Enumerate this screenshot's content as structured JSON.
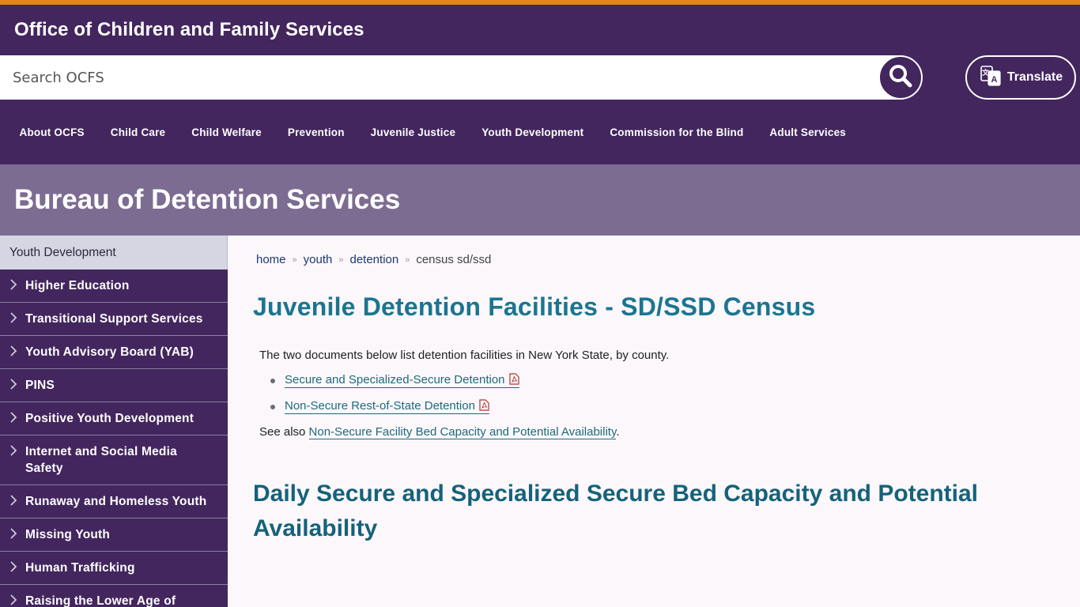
{
  "header": {
    "site_title": "Office of Children and Family Services"
  },
  "search": {
    "placeholder": "Search OCFS",
    "button_icon": "search-icon"
  },
  "translate": {
    "label": "Translate",
    "icon": "translate-icon"
  },
  "main_nav": [
    {
      "label": "About OCFS"
    },
    {
      "label": "Child Care"
    },
    {
      "label": "Child Welfare"
    },
    {
      "label": "Prevention"
    },
    {
      "label": "Juvenile Justice"
    },
    {
      "label": "Youth Development"
    },
    {
      "label": "Commission for the Blind"
    },
    {
      "label": "Adult Services"
    }
  ],
  "banner": {
    "title": "Bureau of Detention Services"
  },
  "sidebar": {
    "heading": "Youth Development",
    "items": [
      {
        "label": "Higher Education"
      },
      {
        "label": "Transitional Support Services"
      },
      {
        "label": "Youth Advisory Board (YAB)"
      },
      {
        "label": "PINS"
      },
      {
        "label": "Positive Youth Development"
      },
      {
        "label": "Internet and Social Media Safety"
      },
      {
        "label": "Runaway and Homeless Youth"
      },
      {
        "label": "Missing Youth"
      },
      {
        "label": "Human Trafficking"
      },
      {
        "label": "Raising the Lower Age of"
      }
    ]
  },
  "breadcrumb": {
    "items": [
      "home",
      "youth",
      "detention"
    ],
    "current": "census sd/ssd"
  },
  "content": {
    "page_title": "Juvenile Detention Facilities - SD/SSD Census",
    "intro": "The two documents below list detention facilities in New York State, by county.",
    "documents": [
      {
        "label": "Secure and Specialized-Secure Detention",
        "icon": "pdf-icon"
      },
      {
        "label": "Non-Secure Rest-of-State Detention",
        "icon": "pdf-icon"
      }
    ],
    "see_also_prefix": "See also ",
    "see_also_link": "Non-Secure Facility Bed Capacity and Potential Availability",
    "see_also_suffix": ".",
    "section_title": "Daily Secure and Specialized Secure Bed Capacity and Potential Availability"
  },
  "colors": {
    "accent_bar": "#e0861a",
    "brand_purple": "#43265e",
    "banner": "#7d6c92",
    "heading_teal": "#1b7590"
  }
}
